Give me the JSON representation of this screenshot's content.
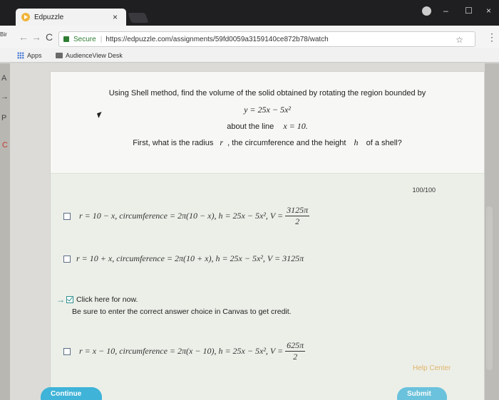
{
  "browser": {
    "tab_title": "Edpuzzle",
    "tab_close": "×",
    "window_controls": {
      "minimize": "–",
      "maximize": "☐",
      "close": "×"
    },
    "nav": {
      "back": "←",
      "forward": "→",
      "reload": "C"
    },
    "omnibox": {
      "secure_label": "Secure",
      "separator": "|",
      "url": "https://edpuzzle.com/assignments/59fd0059a3159140ce872b78/watch"
    },
    "bookmark_star": "☆",
    "menu": "⋮",
    "bookmarks": [
      {
        "label": "Apps",
        "icon": "apps-grid-icon"
      },
      {
        "label": "AudienceView Desk",
        "icon": "folder-icon"
      }
    ]
  },
  "left_fragments": {
    "top": "Bir",
    "a": "A",
    "arrow": "→",
    "p": "P",
    "c": "C"
  },
  "question": {
    "line1": "Using Shell method, find the volume of the solid obtained by rotating the region bounded by",
    "equation": "y = 25x − 5x²",
    "about_label": "about the line",
    "about_value": "x = 10.",
    "line3_start": "First, what is the radius",
    "radius_symbol": "r",
    "line3_mid": ", the circumference and the height",
    "height_symbol": "h",
    "line3_end": "of a shell?"
  },
  "points": "100/100",
  "choices": [
    {
      "text": "r = 10 − x, circumference = 2π(10 − x), h = 25x − 5x², V =",
      "frac_num": "3125π",
      "frac_den": "2"
    },
    {
      "text": "r = 10 + x, circumference = 2π(10 + x), h = 25x − 5x², V = 3125π"
    },
    {
      "text": "r = x − 10, circumference = 2π(x − 10), h = 25x − 5x², V =",
      "frac_num": "625π",
      "frac_den": "2"
    }
  ],
  "feedback": {
    "selected_label": "Click here for now.",
    "note": "Be sure to enter the correct answer choice in Canvas to get credit."
  },
  "help_center": "Help Center",
  "continue_button": "Continue",
  "submit_button": "Submit"
}
